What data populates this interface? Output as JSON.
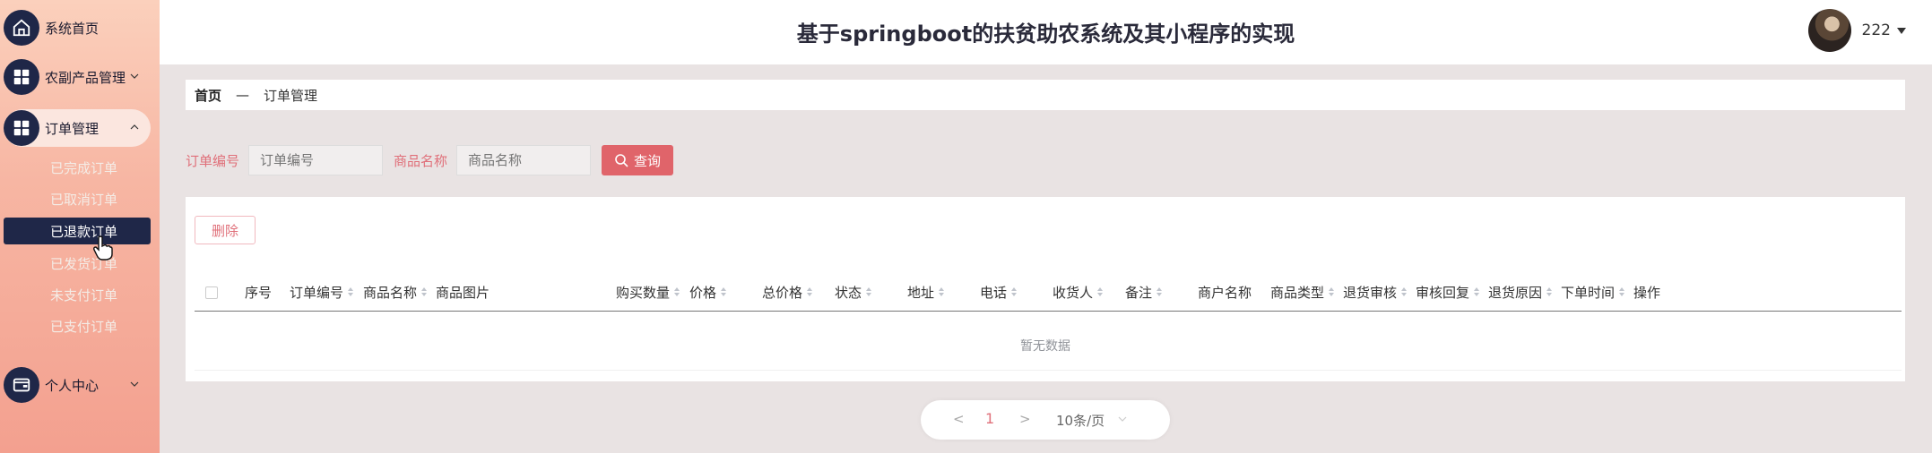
{
  "header": {
    "title": "基于springboot的扶贫助农系统及其小程序的实现",
    "user_name": "222"
  },
  "sidebar": {
    "items": [
      {
        "label": "系统首页",
        "icon": "home-icon"
      },
      {
        "label": "农副产品管理",
        "icon": "grid-icon"
      },
      {
        "label": "订单管理",
        "icon": "grid-icon"
      },
      {
        "label": "个人中心",
        "icon": "wallet-icon"
      }
    ],
    "order_sub_items": [
      "已完成订单",
      "已取消订单",
      "已退款订单",
      "已发货订单",
      "未支付订单",
      "已支付订单"
    ],
    "active_sub_item": "已退款订单"
  },
  "breadcrumb": {
    "home": "首页",
    "separator": "—",
    "current": "订单管理"
  },
  "search": {
    "order_no_label": "订单编号",
    "order_no_placeholder": "订单编号",
    "product_name_label": "商品名称",
    "product_name_placeholder": "商品名称",
    "query_button": "查询"
  },
  "table": {
    "delete_button": "删除",
    "columns": [
      "序号",
      "订单编号",
      "商品名称",
      "商品图片",
      "购买数量",
      "价格",
      "总价格",
      "状态",
      "地址",
      "电话",
      "收货人",
      "备注",
      "商户名称",
      "商品类型",
      "退货审核",
      "审核回复",
      "退货原因",
      "下单时间",
      "操作"
    ],
    "empty_text": "暂无数据"
  },
  "pagination": {
    "prev": "<",
    "current_page": "1",
    "next": ">",
    "page_size": "10条/页"
  },
  "colors": {
    "accent": "#e0646a",
    "sidebar_dark": "#1f2748"
  }
}
